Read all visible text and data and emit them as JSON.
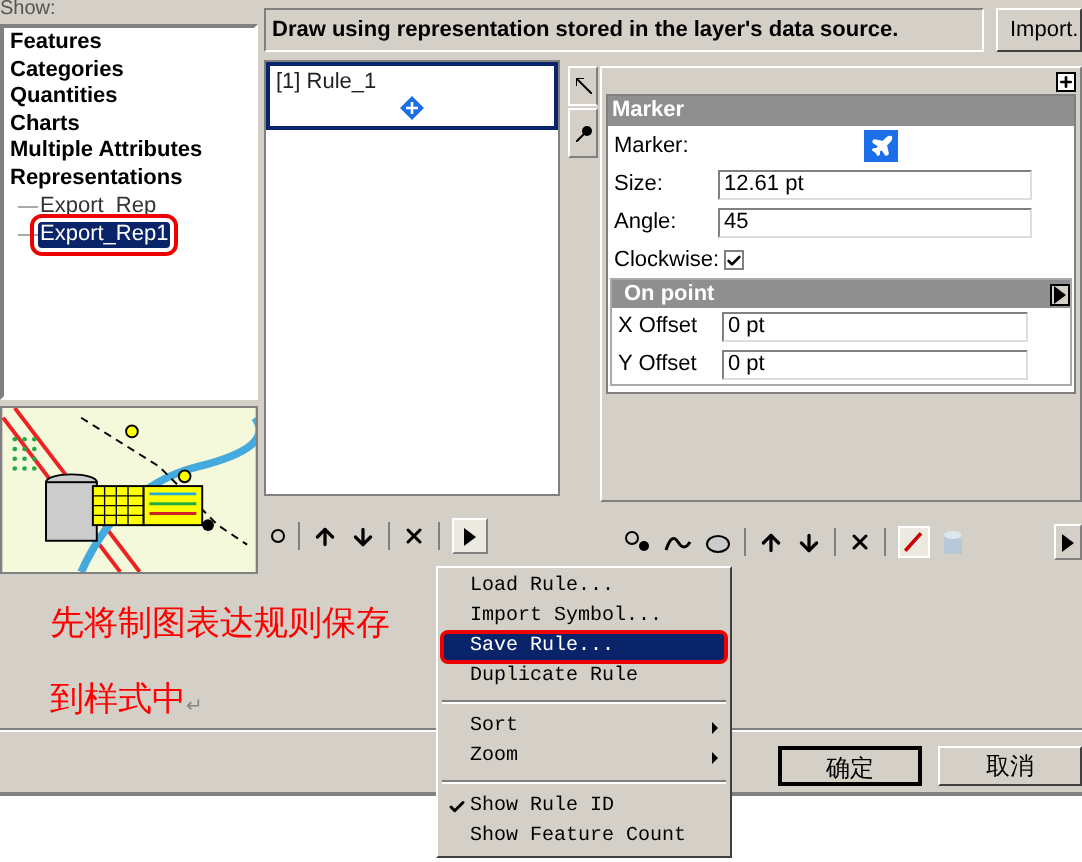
{
  "show_label": "Show:",
  "categories": [
    {
      "label": "Features"
    },
    {
      "label": "Categories"
    },
    {
      "label": "Quantities"
    },
    {
      "label": "Charts"
    },
    {
      "label": "Multiple Attributes"
    },
    {
      "label": "Representations",
      "children": [
        {
          "label": "Export_Rep",
          "selected": false
        },
        {
          "label": "Export_Rep1",
          "selected": true
        }
      ]
    }
  ],
  "description": "Draw using representation stored in the layer's data source.",
  "import_button": "Import.",
  "rules": [
    {
      "label": "[1] Rule_1",
      "selected": true
    }
  ],
  "marker_panel": {
    "title": "Marker",
    "marker_label": "Marker:",
    "fields": [
      {
        "label": "Size:",
        "value": "12.61 pt"
      },
      {
        "label": "Angle:",
        "value": "45"
      }
    ],
    "clockwise": {
      "label": "Clockwise:",
      "checked": true
    },
    "section": "On point",
    "offsets": [
      {
        "label": "X Offset",
        "value": "0 pt"
      },
      {
        "label": "Y Offset",
        "value": "0 pt"
      }
    ]
  },
  "menu": [
    {
      "kind": "item",
      "label": "Load Rule...",
      "selected": false
    },
    {
      "kind": "item",
      "label": "Import Symbol...",
      "selected": false
    },
    {
      "kind": "item",
      "label": "Save Rule...",
      "selected": true
    },
    {
      "kind": "item",
      "label": "Duplicate Rule",
      "selected": false
    },
    {
      "kind": "separator"
    },
    {
      "kind": "submenu",
      "label": "Sort"
    },
    {
      "kind": "submenu",
      "label": "Zoom"
    },
    {
      "kind": "separator"
    },
    {
      "kind": "check",
      "label": "Show Rule ID",
      "checked": true
    },
    {
      "kind": "check",
      "label": "Show Feature Count",
      "checked": false
    }
  ],
  "annotation": {
    "lines": [
      "先将制图表达规则保存",
      "到样式中"
    ],
    "mark": "↵"
  },
  "buttons": [
    "确定",
    "取消"
  ]
}
